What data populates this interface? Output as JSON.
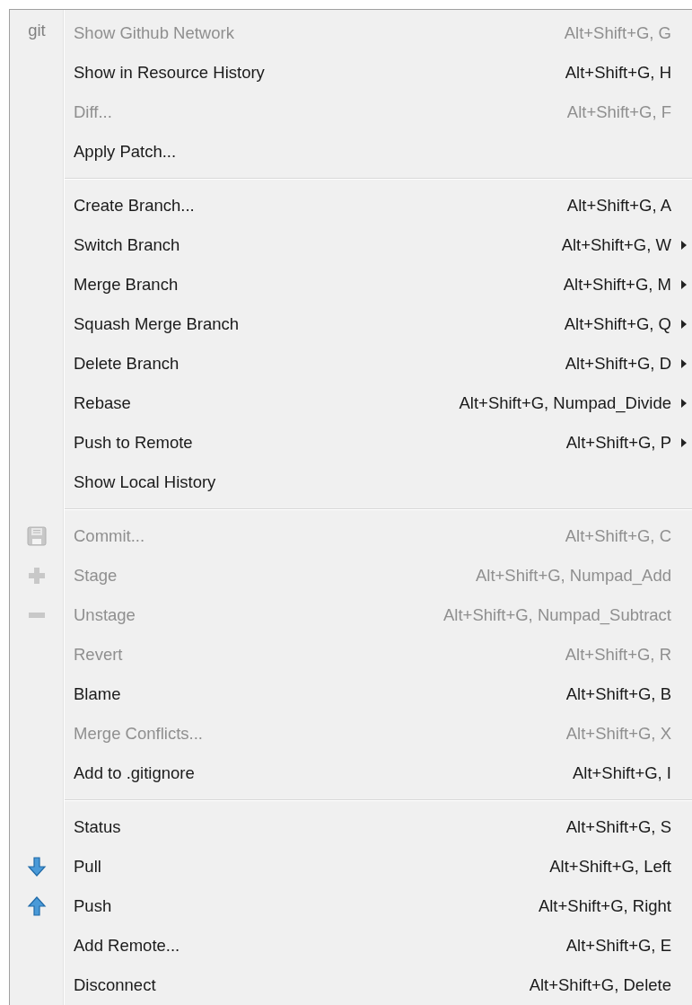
{
  "menu": {
    "groups": [
      {
        "items": [
          {
            "label": "Show Github Network",
            "shortcut": "Alt+Shift+G, G",
            "disabled": true,
            "submenu": false,
            "icon_text": "git"
          },
          {
            "label": "Show in Resource History",
            "shortcut": "Alt+Shift+G, H",
            "disabled": false,
            "submenu": false
          },
          {
            "label": "Diff...",
            "shortcut": "Alt+Shift+G, F",
            "disabled": true,
            "submenu": false
          },
          {
            "label": "Apply Patch...",
            "disabled": false,
            "submenu": false
          }
        ]
      },
      {
        "items": [
          {
            "label": "Create Branch...",
            "shortcut": "Alt+Shift+G, A",
            "disabled": false,
            "submenu": false
          },
          {
            "label": "Switch Branch",
            "shortcut": "Alt+Shift+G, W",
            "disabled": false,
            "submenu": true
          },
          {
            "label": "Merge Branch",
            "shortcut": "Alt+Shift+G, M",
            "disabled": false,
            "submenu": true
          },
          {
            "label": "Squash Merge Branch",
            "shortcut": "Alt+Shift+G, Q",
            "disabled": false,
            "submenu": true
          },
          {
            "label": "Delete Branch",
            "shortcut": "Alt+Shift+G, D",
            "disabled": false,
            "submenu": true
          },
          {
            "label": "Rebase",
            "shortcut": "Alt+Shift+G, Numpad_Divide",
            "disabled": false,
            "submenu": true
          },
          {
            "label": "Push to Remote",
            "shortcut": "Alt+Shift+G, P",
            "disabled": false,
            "submenu": true
          },
          {
            "label": "Show Local History",
            "disabled": false,
            "submenu": false
          }
        ]
      },
      {
        "items": [
          {
            "label": "Commit...",
            "shortcut": "Alt+Shift+G, C",
            "disabled": true,
            "submenu": false,
            "kind": "save"
          },
          {
            "label": "Stage",
            "shortcut": "Alt+Shift+G, Numpad_Add",
            "disabled": true,
            "submenu": false,
            "kind": "plus"
          },
          {
            "label": "Unstage",
            "shortcut": "Alt+Shift+G, Numpad_Subtract",
            "disabled": true,
            "submenu": false,
            "kind": "minus"
          },
          {
            "label": "Revert",
            "shortcut": "Alt+Shift+G, R",
            "disabled": true,
            "submenu": false
          },
          {
            "label": "Blame",
            "shortcut": "Alt+Shift+G, B",
            "disabled": false,
            "submenu": false
          },
          {
            "label": "Merge Conflicts...",
            "shortcut": "Alt+Shift+G, X",
            "disabled": true,
            "submenu": false
          },
          {
            "label": "Add to .gitignore",
            "shortcut": "Alt+Shift+G, I",
            "disabled": false,
            "submenu": false
          }
        ]
      },
      {
        "items": [
          {
            "label": "Status",
            "shortcut": "Alt+Shift+G, S",
            "disabled": false,
            "submenu": false
          },
          {
            "label": "Pull",
            "shortcut": "Alt+Shift+G, Left",
            "disabled": false,
            "submenu": false,
            "kind": "download"
          },
          {
            "label": "Push",
            "shortcut": "Alt+Shift+G, Right",
            "disabled": false,
            "submenu": false,
            "kind": "upload"
          },
          {
            "label": "Add Remote...",
            "shortcut": "Alt+Shift+G, E",
            "disabled": false,
            "submenu": false
          },
          {
            "label": "Disconnect",
            "shortcut": "Alt+Shift+G, Delete",
            "disabled": false,
            "submenu": false
          }
        ]
      }
    ]
  }
}
